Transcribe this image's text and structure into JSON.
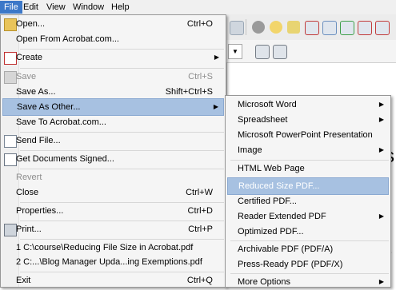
{
  "menubar": {
    "items": [
      "File",
      "Edit",
      "View",
      "Window",
      "Help"
    ]
  },
  "file_menu": {
    "items": [
      {
        "label": "Open...",
        "shortcut": "Ctrl+O",
        "icon": "open-folder-icon"
      },
      {
        "label": "Open From Acrobat.com...",
        "shortcut": ""
      },
      {
        "label": "Create",
        "shortcut": "",
        "icon": "create-pdf-icon",
        "submenu": true
      },
      {
        "label": "Save",
        "shortcut": "Ctrl+S",
        "icon": "save-disk-icon",
        "disabled": true
      },
      {
        "label": "Save As...",
        "shortcut": "Shift+Ctrl+S"
      },
      {
        "label": "Save As Other...",
        "shortcut": "",
        "submenu": true,
        "highlighted": true
      },
      {
        "label": "Save To Acrobat.com...",
        "shortcut": ""
      },
      {
        "label": "Send File...",
        "shortcut": "",
        "icon": "envelope-icon"
      },
      {
        "label": "Get Documents Signed...",
        "shortcut": "",
        "icon": "sign-pen-icon"
      },
      {
        "label": "Revert",
        "shortcut": "",
        "disabled": true
      },
      {
        "label": "Close",
        "shortcut": "Ctrl+W"
      },
      {
        "label": "Properties...",
        "shortcut": "Ctrl+D"
      },
      {
        "label": "Print...",
        "shortcut": "Ctrl+P",
        "icon": "printer-icon"
      },
      {
        "label": "1 C:\\course\\Reducing File Size in Acrobat.pdf",
        "shortcut": ""
      },
      {
        "label": "2 C:...\\Blog Manager Upda...ing Exemptions.pdf",
        "shortcut": ""
      },
      {
        "label": "Exit",
        "shortcut": "Ctrl+Q"
      }
    ]
  },
  "save_as_other_menu": {
    "items": [
      {
        "label": "Microsoft Word",
        "submenu": true
      },
      {
        "label": "Spreadsheet",
        "submenu": true
      },
      {
        "label": "Microsoft PowerPoint Presentation"
      },
      {
        "label": "Image",
        "submenu": true
      },
      {
        "label": "HTML Web Page"
      },
      {
        "label": "Reduced Size PDF...",
        "highlighted": true
      },
      {
        "label": "Certified PDF..."
      },
      {
        "label": "Reader Extended PDF",
        "submenu": true
      },
      {
        "label": "Optimized PDF..."
      },
      {
        "label": "Archivable PDF (PDF/A)"
      },
      {
        "label": "Press-Ready PDF (PDF/X)"
      },
      {
        "label": "More Options",
        "submenu": true
      }
    ]
  },
  "colors": {
    "menubar_active": "#3c78c8",
    "highlight": "#a7c1e1"
  }
}
